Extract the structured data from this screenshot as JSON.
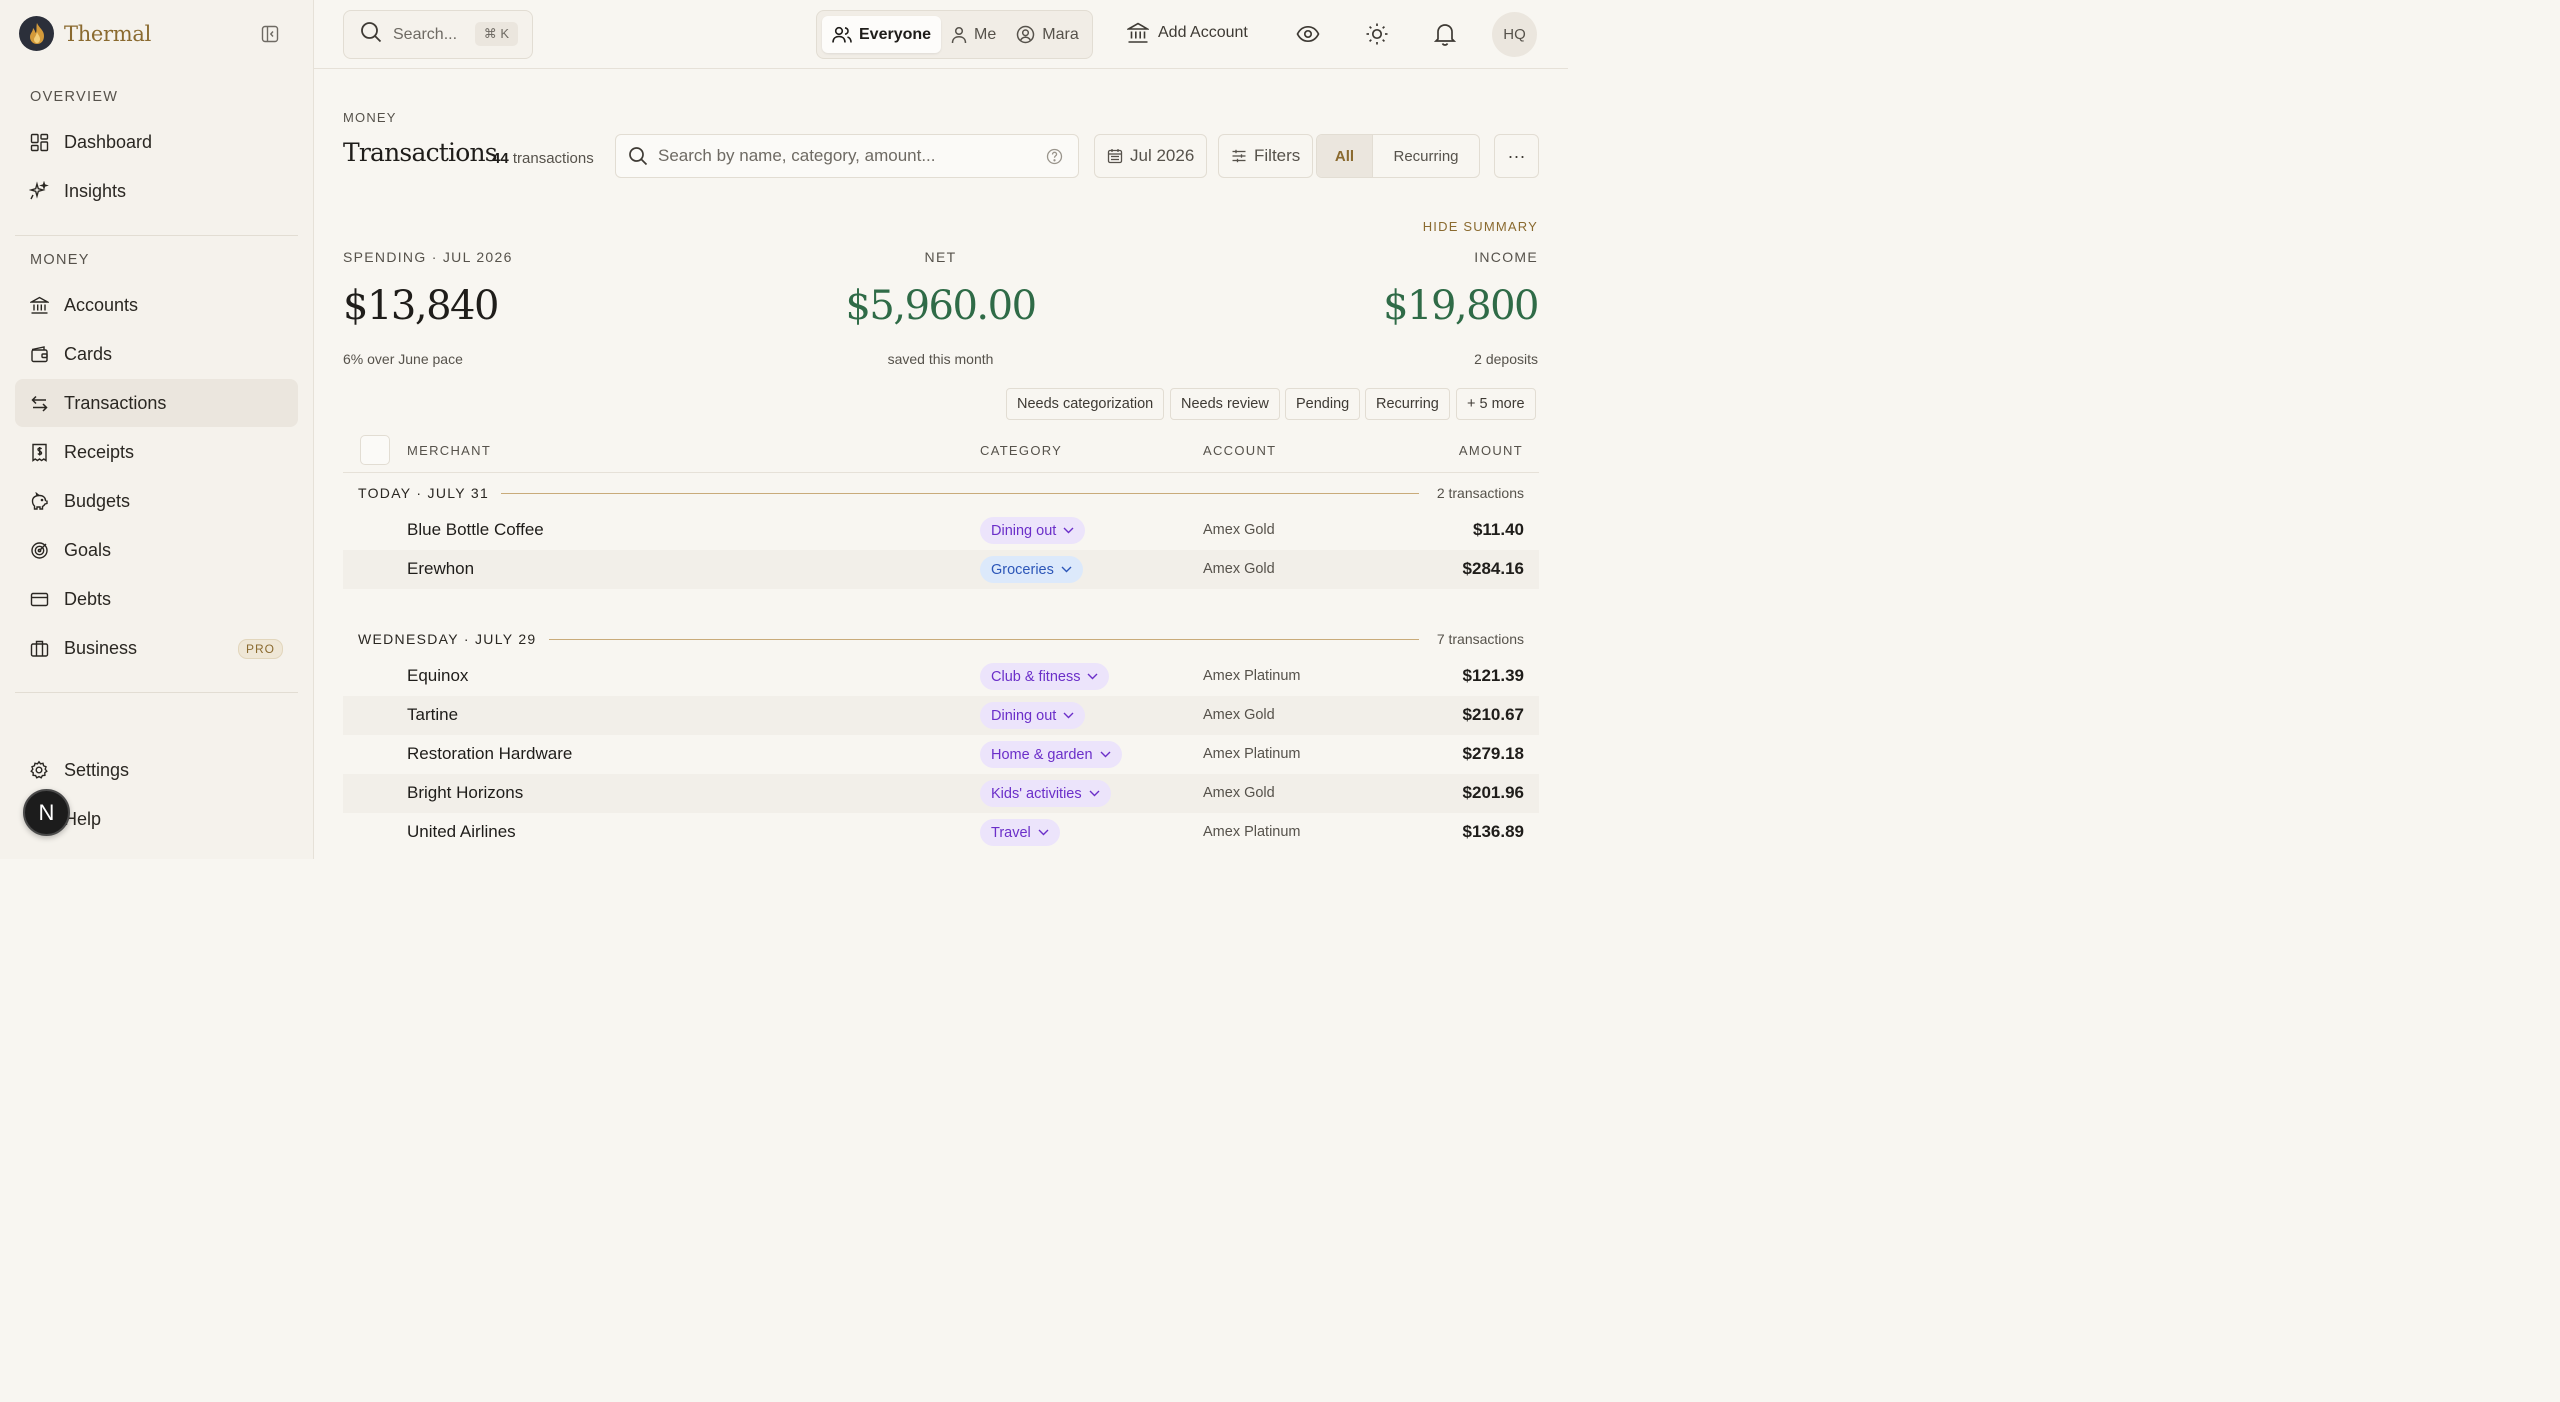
{
  "brand": {
    "name": "Thermal"
  },
  "sidebar": {
    "overview_label": "OVERVIEW",
    "overview_items": [
      {
        "label": "Dashboard",
        "icon": "dashboard-icon"
      },
      {
        "label": "Insights",
        "icon": "sparkles-icon"
      }
    ],
    "money_label": "MONEY",
    "money_items": [
      {
        "label": "Accounts",
        "icon": "bank-icon"
      },
      {
        "label": "Cards",
        "icon": "wallet-icon"
      },
      {
        "label": "Transactions",
        "icon": "arrows-swap-icon",
        "active": true
      },
      {
        "label": "Receipts",
        "icon": "receipt-icon"
      },
      {
        "label": "Budgets",
        "icon": "piggy-bank-icon"
      },
      {
        "label": "Goals",
        "icon": "target-icon"
      },
      {
        "label": "Debts",
        "icon": "credit-card-icon"
      },
      {
        "label": "Business",
        "icon": "briefcase-icon",
        "badge": "PRO"
      }
    ],
    "settings": "Settings",
    "help": "Help",
    "floating_avatar": "N"
  },
  "topbar": {
    "search_placeholder": "Search...",
    "search_shortcut": "⌘ K",
    "scope": [
      {
        "label": "Everyone",
        "active": true
      },
      {
        "label": "Me"
      },
      {
        "label": "Mara"
      }
    ],
    "add_account": "Add Account",
    "user_initials": "HQ"
  },
  "page": {
    "eyebrow": "MONEY",
    "title": "Transactions",
    "count_number": "44",
    "count_label": "transactions",
    "search_placeholder": "Search by name, category, amount...",
    "period": "Jul 2026",
    "filters": "Filters",
    "toggle_all": "All",
    "toggle_recurring": "Recurring",
    "more": "···"
  },
  "summary": {
    "hide": "HIDE SUMMARY",
    "spending": {
      "label": "SPENDING · JUL 2026",
      "value": "$13,840",
      "sub": "6% over June pace"
    },
    "net": {
      "label": "NET",
      "value": "$5,960.00",
      "sub": "saved this month"
    },
    "income": {
      "label": "INCOME",
      "value": "$19,800",
      "sub": "2 deposits"
    }
  },
  "quick_filters": [
    "Needs categorization",
    "Needs review",
    "Pending",
    "Recurring",
    "+ 5 more"
  ],
  "table": {
    "headers": {
      "merchant": "MERCHANT",
      "category": "CATEGORY",
      "account": "ACCOUNT",
      "amount": "AMOUNT"
    },
    "groups": [
      {
        "label": "TODAY · JULY 31",
        "count": "2 transactions",
        "rows": [
          {
            "merchant": "Blue Bottle Coffee",
            "category": "Dining out",
            "account": "Amex Gold",
            "amount": "$11.40"
          },
          {
            "merchant": "Erewhon",
            "category": "Groceries",
            "account": "Amex Gold",
            "amount": "$284.16"
          }
        ]
      },
      {
        "label": "WEDNESDAY · JULY 29",
        "count": "7 transactions",
        "rows": [
          {
            "merchant": "Equinox",
            "category": "Club & fitness",
            "account": "Amex Platinum",
            "amount": "$121.39"
          },
          {
            "merchant": "Tartine",
            "category": "Dining out",
            "account": "Amex Gold",
            "amount": "$210.67"
          },
          {
            "merchant": "Restoration Hardware",
            "category": "Home & garden",
            "account": "Amex Platinum",
            "amount": "$279.18"
          },
          {
            "merchant": "Bright Horizons",
            "category": "Kids' activities",
            "account": "Amex Gold",
            "amount": "$201.96"
          },
          {
            "merchant": "United Airlines",
            "category": "Travel",
            "account": "Amex Platinum",
            "amount": "$136.89"
          }
        ]
      }
    ]
  },
  "colors": {
    "accent": "#8a6a2f",
    "positive": "#2f6b47",
    "purple_chip_bg": "#ece4fb",
    "purple_chip_text": "#6b2fc9",
    "blue_chip_bg": "#dce9fb",
    "blue_chip_text": "#2c56b8"
  }
}
